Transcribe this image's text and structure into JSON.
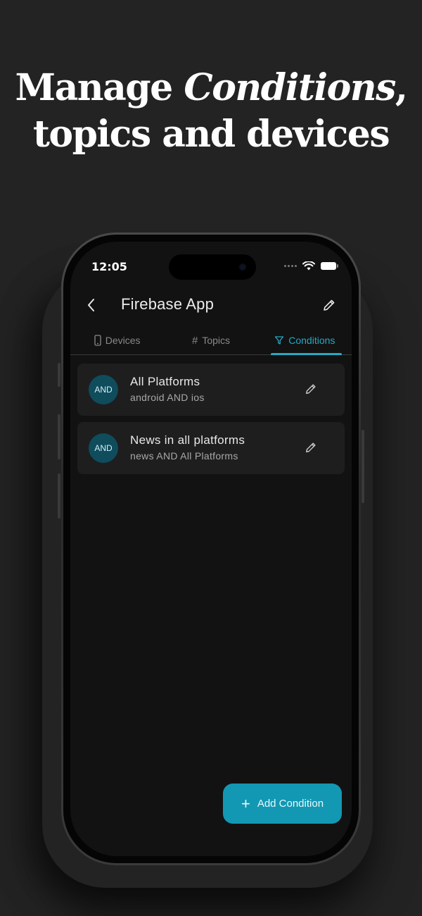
{
  "headline": {
    "line1_prefix": "Manage ",
    "line1_accent": "Conditions",
    "line1_suffix": ",",
    "line2": "topics and devices"
  },
  "status_bar": {
    "time": "12:05"
  },
  "app_bar": {
    "title": "Firebase App",
    "back_icon": "chevron-left-icon",
    "edit_icon": "pencil-icon"
  },
  "tabs": [
    {
      "label": "Devices",
      "icon": "phone-icon",
      "active": false
    },
    {
      "label": "Topics",
      "icon": "hash-icon",
      "glyph": "#",
      "active": false
    },
    {
      "label": "Conditions",
      "icon": "filter-icon",
      "active": true
    }
  ],
  "conditions": [
    {
      "badge": "AND",
      "name": "All Platforms",
      "expression": "android AND ios"
    },
    {
      "badge": "AND",
      "name": "News in all platforms",
      "expression": "news AND All Platforms"
    }
  ],
  "fab": {
    "label": "Add Condition",
    "icon": "plus-icon",
    "glyph": "+"
  },
  "colors": {
    "accent": "#27a9c4",
    "fab": "#1398b3",
    "badge": "#0f4c5c",
    "background": "#232323",
    "screen": "#121212",
    "card": "#1e1e1e"
  }
}
